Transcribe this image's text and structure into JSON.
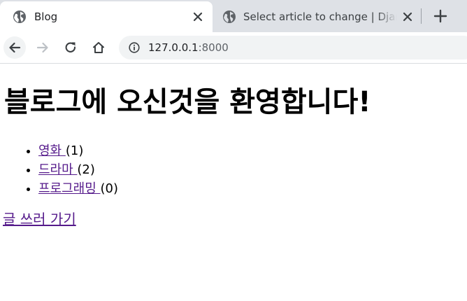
{
  "tabs": [
    {
      "title": "Blog",
      "icon": "globe-icon",
      "active": true
    },
    {
      "title": "Select article to change | Django",
      "icon": "globe-icon",
      "active": false
    }
  ],
  "toolbar": {
    "url_host": "127.0.0.1",
    "url_port": ":8000"
  },
  "page": {
    "heading": "블로그에 오신것을 환영합니다!",
    "categories": [
      {
        "name": "영화 ",
        "count": "(1)"
      },
      {
        "name": "드라마 ",
        "count": "(2)"
      },
      {
        "name": "프로그래밍 ",
        "count": "(0)"
      }
    ],
    "write_link": "글 쓰러 가기"
  },
  "colors": {
    "tabstrip": "#dee1e6",
    "visited_link": "#551a8b",
    "omnibox": "#f1f3f4"
  }
}
